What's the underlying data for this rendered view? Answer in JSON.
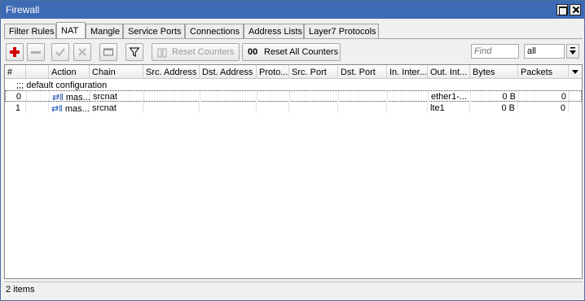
{
  "window": {
    "title": "Firewall"
  },
  "tabs": [
    "Filter Rules",
    "NAT",
    "Mangle",
    "Service Ports",
    "Connections",
    "Address Lists",
    "Layer7 Protocols"
  ],
  "active_tab": "NAT",
  "toolbar": {
    "reset_counters": "Reset Counters",
    "reset_all_prefix": "00",
    "reset_all_counters": "Reset All Counters",
    "find_placeholder": "Find",
    "filter_value": "all"
  },
  "columns": [
    "#",
    "",
    "Action",
    "Chain",
    "Src. Address",
    "Dst. Address",
    "Proto...",
    "Src. Port",
    "Dst. Port",
    "In. Inter...",
    "Out. Int...",
    "Bytes",
    "Packets"
  ],
  "comment": ";;; default configuration",
  "rows": [
    {
      "index": "0",
      "action_icon": "⇄‖",
      "action": "mas...",
      "chain": "srcnat",
      "out_interface": "ether1-...",
      "bytes": "0 B",
      "packets": "0"
    },
    {
      "index": "1",
      "action_icon": "⇄‖",
      "action": "mas...",
      "chain": "srcnat",
      "out_interface": "lte1",
      "bytes": "0 B",
      "packets": "0"
    }
  ],
  "status": {
    "items_count": "2 items"
  },
  "colors": {
    "title_bar": "#3d6ab4",
    "add_icon": "#d00000"
  }
}
